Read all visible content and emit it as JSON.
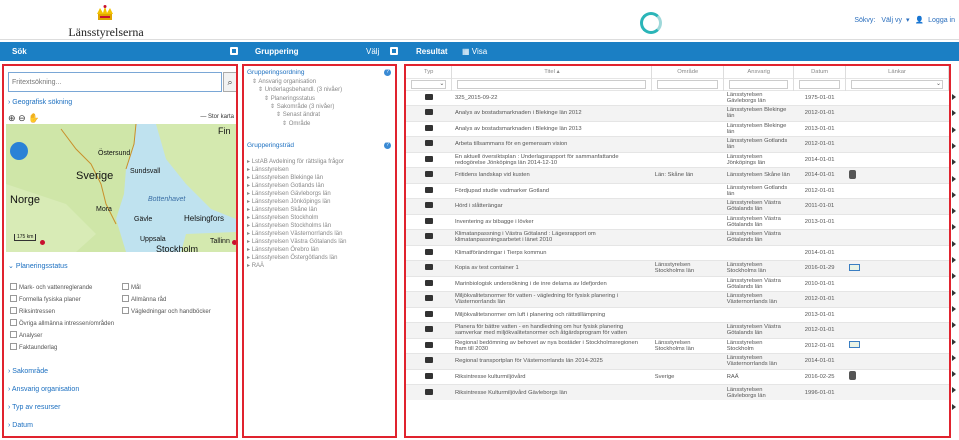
{
  "brand": {
    "name": "Länsstyrelserna"
  },
  "toplinks": {
    "sokvy": "Sökvy:",
    "valj_vy": "Välj vy",
    "logga_in": "Logga in"
  },
  "headers": {
    "sok": "Sök",
    "gruppering": "Gruppering",
    "valj": "Välj",
    "resultat": "Resultat",
    "visa": "Visa"
  },
  "search": {
    "placeholder": "Fritextsökning...",
    "geo": "Geografisk sökning",
    "storkarta": "Stor karta"
  },
  "map_labels": [
    "Fin",
    "Östersund",
    "Sverige",
    "Sundsvall",
    "Norge",
    "Bottenhavet",
    "Mora",
    "Gävle",
    "Helsingfors",
    "Uppsala",
    "Tallinn",
    "Stockholm",
    "175 km"
  ],
  "planering": {
    "title": "Planeringsstatus",
    "left": [
      "Mark- och vattenreglerande",
      "Formella fysiska planer",
      "Riksintressen",
      "Övriga allmänna intressen/områden",
      "Analyser",
      "Faktaunderlag"
    ],
    "right": [
      "Mål",
      "Allmänna råd",
      "Vägledningar och handböcker"
    ]
  },
  "sections": [
    "Sakområde",
    "Ansvarig organisation",
    "Typ av resurser",
    "Datum"
  ],
  "gruppering": {
    "ordning_title": "Grupperingsordning",
    "ordning": [
      "Ansvarig organisation",
      "Underlagsbehandl. (3 nivåer)",
      "Planeringsstatus",
      "Sakområde (3 nivåer)",
      "Senast ändrat",
      "Område"
    ],
    "trad_title": "Grupperingsträd",
    "trad": [
      "LstAB Avdelning för rättsliga frågor",
      "Länsstyrelsen",
      "Länsstyrelsen Blekinge län",
      "Länsstyrelsen Gotlands län",
      "Länsstyrelsen Gävleborgs län",
      "Länsstyrelsen Jönköpings län",
      "Länsstyrelsen Skåne län",
      "Länsstyrelsen Stockholm",
      "Länsstyrelsen Stockholms län",
      "Länsstyrelsen Västernorrlands län",
      "Länsstyrelsen Västra Götalands län",
      "Länsstyrelsen Örebro län",
      "Länsstyrelsen Östergötlands län",
      "RAÄ"
    ]
  },
  "table": {
    "columns": [
      "Typ",
      "Titel",
      "Område",
      "Ansvarig",
      "Datum",
      "Länkar"
    ],
    "rows": [
      {
        "titel": "325_2015-09-22",
        "omrade": "",
        "ansvarig": "Länsstyrelsen Gävleborgs län",
        "datum": "1975-01-01",
        "link": ""
      },
      {
        "titel": "Analys av bostadsmarknaden i Blekinge län 2012",
        "omrade": "",
        "ansvarig": "Länsstyrelsen Blekinge län",
        "datum": "2012-01-01",
        "link": ""
      },
      {
        "titel": "Analys av bostadsmarknaden i Blekinge län 2013",
        "omrade": "",
        "ansvarig": "Länsstyrelsen Blekinge län",
        "datum": "2013-01-01",
        "link": ""
      },
      {
        "titel": "Arbeta tillsammans för en gemensam vision",
        "omrade": "",
        "ansvarig": "Länsstyrelsen Gotlands län",
        "datum": "2012-01-01",
        "link": ""
      },
      {
        "titel": "En aktuell översiktsplan : Underlagsrapport för sammanfattande redogörelse Jönköpings län 2014-12-10",
        "omrade": "",
        "ansvarig": "Länsstyrelsen Jönköpings län",
        "datum": "2014-01-01",
        "link": ""
      },
      {
        "titel": "Fritidens landskap vid kusten",
        "omrade": "Län: Skåne län",
        "ansvarig": "Länsstyrelsen Skåne län",
        "datum": "2014-01-01",
        "link": "db"
      },
      {
        "titel": "Fördjupad studie vadmarker Gotland",
        "omrade": "",
        "ansvarig": "Länsstyrelsen Gotlands län",
        "datum": "2012-01-01",
        "link": ""
      },
      {
        "titel": "Hörd i slåtterängar",
        "omrade": "",
        "ansvarig": "Länsstyrelsen Västra Götalands län",
        "datum": "2011-01-01",
        "link": ""
      },
      {
        "titel": "Inventering av bibagge i lövker",
        "omrade": "",
        "ansvarig": "Länsstyrelsen Västra Götalands län",
        "datum": "2013-01-01",
        "link": ""
      },
      {
        "titel": "Klimatanpassning i Västra Götaland : Lägesrapport om klimatanpassningsarbetet i länet 2010",
        "omrade": "",
        "ansvarig": "Länsstyrelsen Västra Götalands län",
        "datum": "",
        "link": ""
      },
      {
        "titel": "Klimatförändringar i Tierps kommun",
        "omrade": "",
        "ansvarig": "",
        "datum": "2014-01-01",
        "link": ""
      },
      {
        "titel": "Kopia av test container 1",
        "omrade": "Länsstyrelsen Stockholms län",
        "ansvarig": "Länsstyrelsen Stockholms län",
        "datum": "2016-01-29",
        "link": "badge"
      },
      {
        "titel": "Marinbiologisk undersökning i de inre delarna av Idefjorden",
        "omrade": "",
        "ansvarig": "Länsstyrelsen Västra Götalands län",
        "datum": "2010-01-01",
        "link": ""
      },
      {
        "titel": "Miljökvalitetsnormer för vatten - vägledning för fysisk planering i Västernorrlands län",
        "omrade": "",
        "ansvarig": "Länsstyrelsen Västernorrlands län",
        "datum": "2012-01-01",
        "link": ""
      },
      {
        "titel": "Miljökvalitetsnormer om luft i planering och rättstillämpning",
        "omrade": "",
        "ansvarig": "",
        "datum": "2013-01-01",
        "link": ""
      },
      {
        "titel": "Planera för bättre vatten - en handledning om hur fysisk planering samverkar med miljökvalitetsnormer och åtgärdsprogram för vatten",
        "omrade": "",
        "ansvarig": "Länsstyrelsen Västra Götalands län",
        "datum": "2012-01-01",
        "link": ""
      },
      {
        "titel": "Regional bedömning av behovet av nya bostäder i Stockholmsregionen fram till 2030",
        "omrade": "Länsstyrelsen Stockholms län",
        "ansvarig": "Länsstyrelsen Stockholm",
        "datum": "2012-01-01",
        "link": "badge"
      },
      {
        "titel": "Regional transportplan för Västernorrlands län 2014-2025",
        "omrade": "",
        "ansvarig": "Länsstyrelsen Västernorrlands län",
        "datum": "2014-01-01",
        "link": ""
      },
      {
        "titel": "Riksintresse kulturmiljövård",
        "omrade": "Sverige",
        "ansvarig": "RAÄ",
        "datum": "2016-02-25",
        "link": "db"
      },
      {
        "titel": "Riksintresse Kulturmiljövård Gävleborgs län",
        "omrade": "",
        "ansvarig": "Länsstyrelsen Gävleborgs län",
        "datum": "1996-01-01",
        "link": ""
      }
    ]
  },
  "colors": {
    "accent": "#1b7fc4",
    "highlight": "#e0232e"
  }
}
